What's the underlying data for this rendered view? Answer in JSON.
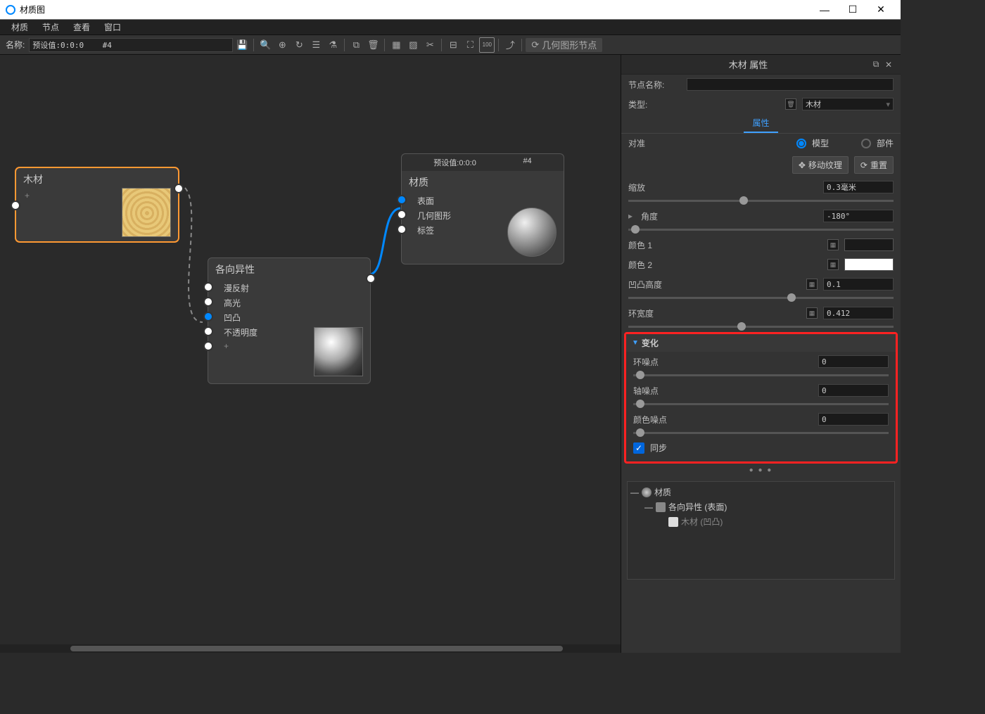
{
  "window": {
    "title": "材质图"
  },
  "menus": [
    "材质",
    "节点",
    "查看",
    "窗口"
  ],
  "toolbar": {
    "name_label": "名称:",
    "name_value": "预设值:0:0:0    #4",
    "geo_node_btn": "几何图形节点"
  },
  "nodes": {
    "wood": {
      "title": "木材",
      "plus": "+"
    },
    "aniso": {
      "title": "各向异性",
      "ports": [
        "漫反射",
        "高光",
        "凹凸",
        "不透明度",
        "+"
      ]
    },
    "mat": {
      "header_preset": "预设值:0:0:0",
      "header_id": "#4",
      "title": "材质",
      "ports": [
        "表面",
        "几何图形",
        "标签"
      ]
    }
  },
  "props": {
    "panel_title": "木材 属性",
    "node_name_label": "节点名称:",
    "type_label": "类型:",
    "type_value": "木材",
    "tab_props": "属性",
    "align_label": "对准",
    "align_model": "模型",
    "align_part": "部件",
    "move_btn": "移动纹理",
    "reset_btn": "重置",
    "scale_label": "缩放",
    "scale_value": "0.3毫米",
    "angle_label": "角度",
    "angle_value": "-180°",
    "color1_label": "颜色 1",
    "color2_label": "颜色 2",
    "bump_label": "凹凸高度",
    "bump_value": "0.1",
    "ring_label": "环宽度",
    "ring_value": "0.412",
    "variation_header": "变化",
    "ring_noise_label": "环噪点",
    "ring_noise_value": "0",
    "axis_noise_label": "轴噪点",
    "axis_noise_value": "0",
    "color_noise_label": "颜色噪点",
    "color_noise_value": "0",
    "sync_label": "同步"
  },
  "tree": {
    "row1": "材质",
    "row2": "各向异性 (表面)",
    "row3": "木材 (凹凸)"
  }
}
